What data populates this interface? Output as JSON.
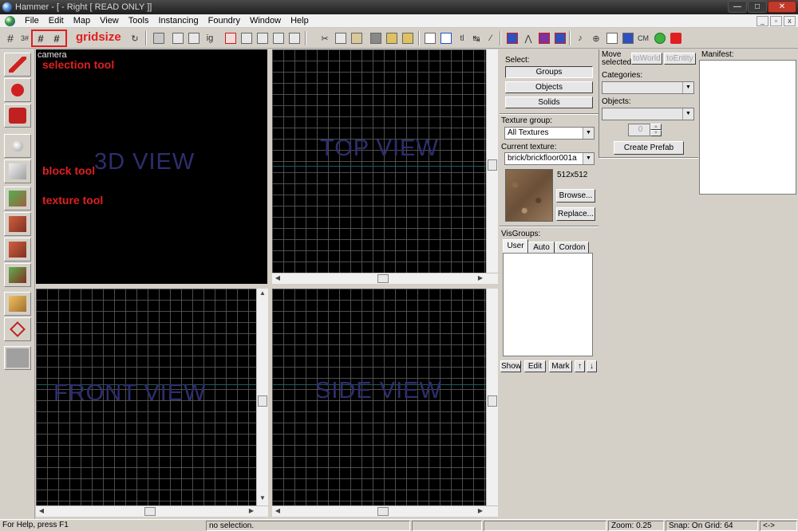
{
  "window": {
    "title": "Hammer - [ - Right [ READ ONLY ]]",
    "controls": [
      "—",
      "□",
      "✕"
    ]
  },
  "menu": [
    "File",
    "Edit",
    "Map",
    "View",
    "Tools",
    "Instancing",
    "Foundry",
    "Window",
    "Help"
  ],
  "mdi_controls": [
    "_",
    "▫",
    "x"
  ],
  "toolbar": {
    "annotation": "gridsize",
    "text_buttons": {
      "tl": "tl",
      "cm": "CM"
    }
  },
  "viewports": {
    "camera_label": "camera",
    "views": [
      "3D VIEW",
      "TOP VIEW",
      "FRONT VIEW",
      "SIDE VIEW"
    ]
  },
  "annotations": {
    "selection": "selection tool",
    "block": "block tool",
    "texture": "texture tool"
  },
  "select_panel": {
    "label": "Select:",
    "buttons": [
      "Groups",
      "Objects",
      "Solids"
    ]
  },
  "texture_panel": {
    "group_label": "Texture group:",
    "group_value": "All Textures",
    "current_label": "Current texture:",
    "current_value": "brick/brickfloor001a",
    "size": "512x512",
    "browse": "Browse...",
    "replace": "Replace..."
  },
  "visgroups": {
    "label": "VisGroups:",
    "tabs": [
      "User",
      "Auto",
      "Cordon"
    ],
    "active_tab": "User",
    "buttons": [
      "Show",
      "Edit",
      "Mark"
    ],
    "arrows": [
      "↑",
      "↓"
    ]
  },
  "entity_panel": {
    "move_label": "Move\nselected:",
    "move_line1": "Move",
    "move_line2": "selected:",
    "to_world": "toWorld",
    "to_entity": "toEntity",
    "categories_label": "Categories:",
    "objects_label": "Objects:",
    "spinner_value": "0",
    "create_prefab": "Create Prefab"
  },
  "manifest": {
    "label": "Manifest:"
  },
  "status": {
    "help": "For Help, press F1",
    "selection": "no selection.",
    "zoom": "Zoom: 0.25",
    "snap": "Snap: On Grid: 64",
    "arrows": "<->"
  },
  "colors": {
    "viewport_bg": "#000000",
    "grid_line": "#5a5a5a",
    "view_label": "#2e2e6e",
    "annotation": "#e02020",
    "ui_face": "#d4d0c8"
  }
}
